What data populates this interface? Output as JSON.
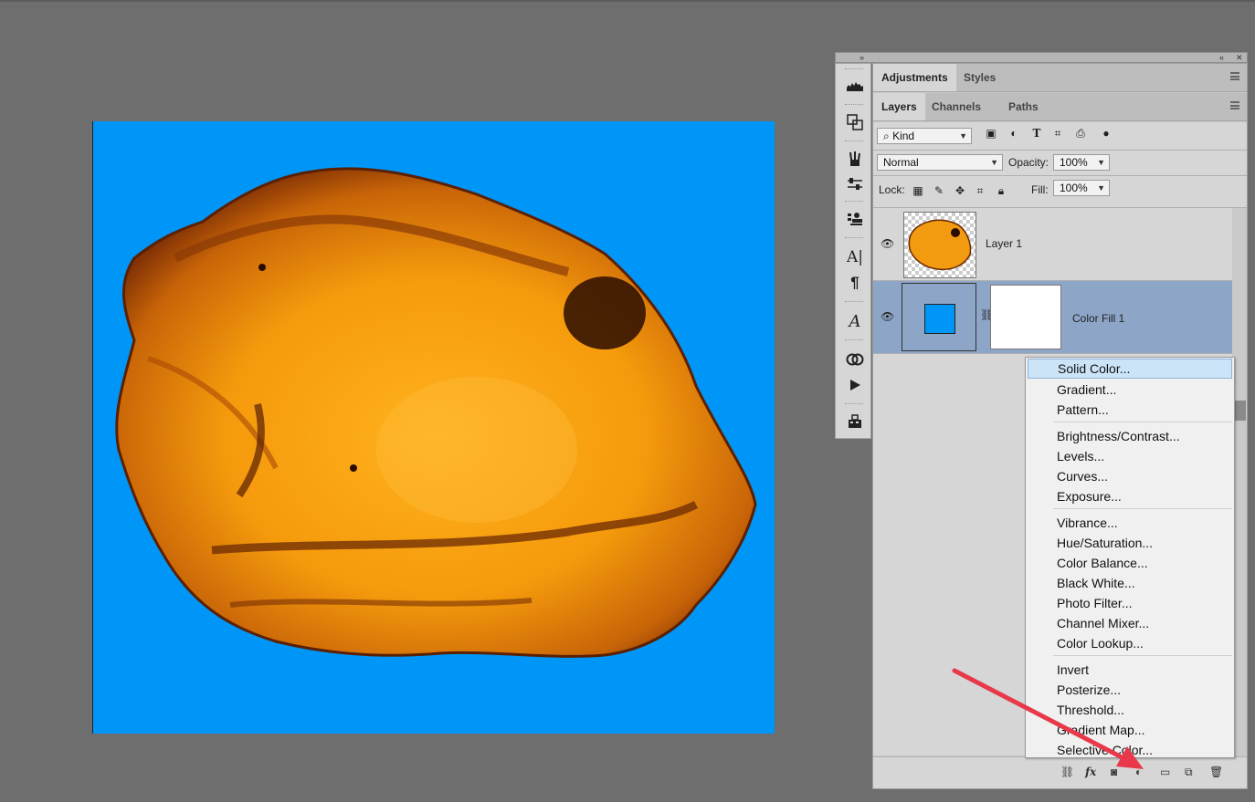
{
  "colors": {
    "workspace": "#6e6e6e",
    "fill_color": "#0096f7",
    "amber": "#f29a10",
    "panel": "#d6d6d6",
    "selected_layer": "#8da5c7",
    "arrow": "#e8394a",
    "menu_highlight": "#cce4f7"
  },
  "panel_top_tabs": [
    {
      "label": "Adjustments",
      "active": true
    },
    {
      "label": "Styles",
      "active": false
    }
  ],
  "layers_tabs": [
    {
      "label": "Layers",
      "active": true
    },
    {
      "label": "Channels",
      "active": false
    },
    {
      "label": "Paths",
      "active": false
    }
  ],
  "filter": {
    "kind": "Kind"
  },
  "blend": {
    "mode": "Normal",
    "opacity_label": "Opacity:",
    "opacity": "100%"
  },
  "lock": {
    "label": "Lock:",
    "fill_label": "Fill:",
    "fill": "100%"
  },
  "layers": [
    {
      "name": "Layer 1",
      "visible": true,
      "selected": false
    },
    {
      "name": "Color Fill 1",
      "visible": true,
      "selected": true
    }
  ],
  "menu": {
    "groups": [
      [
        "Solid Color...",
        "Gradient...",
        "Pattern..."
      ],
      [
        "Brightness/Contrast...",
        "Levels...",
        "Curves...",
        "Exposure..."
      ],
      [
        "Vibrance...",
        "Hue/Saturation...",
        "Color Balance...",
        "Black  White...",
        "Photo Filter...",
        "Channel Mixer...",
        "Color Lookup..."
      ],
      [
        "Invert",
        "Posterize...",
        "Threshold...",
        "Gradient Map...",
        "Selective Color..."
      ]
    ],
    "highlighted": "Solid Color..."
  },
  "bottom_icons": [
    "link-icon",
    "fx-icon",
    "mask-icon",
    "adjustment-icon",
    "folder-icon",
    "new-layer-icon",
    "trash-icon"
  ],
  "bottom_labels": {
    "fx": "fx"
  }
}
